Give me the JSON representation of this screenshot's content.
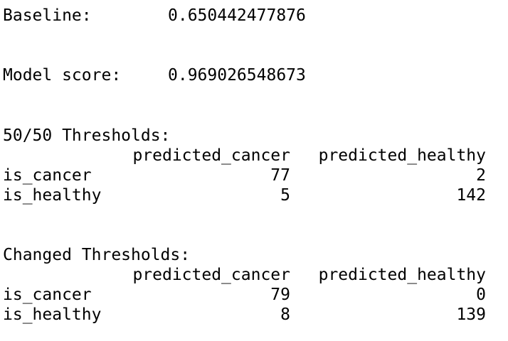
{
  "baseline": {
    "label": "Baseline:",
    "value": "0.650442477876"
  },
  "model_score": {
    "label": "Model score:",
    "value": "0.969026548673"
  },
  "tables": [
    {
      "title": "50/50 Thresholds:",
      "columns": [
        "predicted_cancer",
        "predicted_healthy"
      ],
      "rows": [
        {
          "label": "is_cancer",
          "values": [
            "77",
            "2"
          ]
        },
        {
          "label": "is_healthy",
          "values": [
            "5",
            "142"
          ]
        }
      ]
    },
    {
      "title": "Changed Thresholds:",
      "columns": [
        "predicted_cancer",
        "predicted_healthy"
      ],
      "rows": [
        {
          "label": "is_cancer",
          "values": [
            "79",
            "0"
          ]
        },
        {
          "label": "is_healthy",
          "values": [
            "8",
            "139"
          ]
        }
      ]
    }
  ]
}
